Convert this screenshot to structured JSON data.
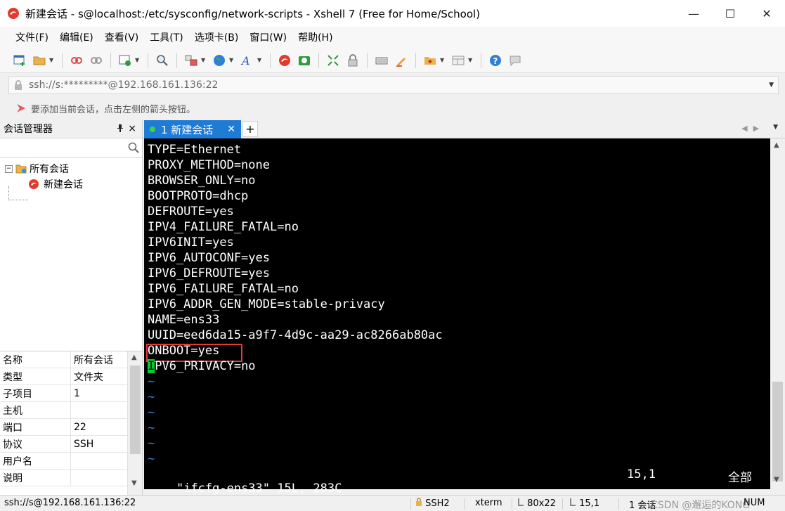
{
  "window": {
    "title": "新建会话 - s@localhost:/etc/sysconfig/network-scripts - Xshell 7 (Free for Home/School)",
    "minimize": "—",
    "maximize": "☐",
    "close": "✕"
  },
  "menu": [
    "文件(F)",
    "编辑(E)",
    "查看(V)",
    "工具(T)",
    "选项卡(B)",
    "窗口(W)",
    "帮助(H)"
  ],
  "address": {
    "value": "ssh://s:*********@192.168.161.136:22"
  },
  "hint": "要添加当前会话，点击左侧的箭头按钮。",
  "session_manager": {
    "title": "会话管理器",
    "pin": "ᵖ",
    "close": "×",
    "search_placeholder": "",
    "tree": {
      "root": "所有会话",
      "toggle": "−",
      "child": "新建会话"
    },
    "properties": [
      {
        "key": "名称",
        "value": "所有会话"
      },
      {
        "key": "类型",
        "value": "文件夹"
      },
      {
        "key": "子项目",
        "value": "1"
      },
      {
        "key": "主机",
        "value": ""
      },
      {
        "key": "端口",
        "value": "22"
      },
      {
        "key": "协议",
        "value": "SSH"
      },
      {
        "key": "用户名",
        "value": ""
      },
      {
        "key": "说明",
        "value": ""
      }
    ]
  },
  "tabs": {
    "active_label": "1 新建会话",
    "close": "✕",
    "add": "+"
  },
  "terminal": {
    "lines": [
      "TYPE=Ethernet",
      "PROXY_METHOD=none",
      "BROWSER_ONLY=no",
      "BOOTPROTO=dhcp",
      "DEFROUTE=yes",
      "IPV4_FAILURE_FATAL=no",
      "IPV6INIT=yes",
      "IPV6_AUTOCONF=yes",
      "IPV6_DEFROUTE=yes",
      "IPV6_FAILURE_FATAL=no",
      "IPV6_ADDR_GEN_MODE=stable-privacy",
      "NAME=ens33",
      "UUID=eed6da15-a9f7-4d9c-aa29-ac8266ab80ac",
      "ONBOOT=yes"
    ],
    "cursor_char": "I",
    "cursor_rest": "PV6_PRIVACY=no",
    "tilde": "~",
    "tilde_count": 6,
    "status_file": "\"ifcfg-ens33\" 15L, 283C",
    "status_pos": "15,1",
    "status_all": "全部"
  },
  "statusbar": {
    "connection": "ssh://s@192.168.161.136:22",
    "protocol": "SSH2",
    "terminal": "xterm",
    "size": "80x22",
    "cursor": "15,1",
    "sessions": "1 会话",
    "num": "NUM",
    "watermark": "CSDN @邂逅的KONG"
  },
  "colors": {
    "accent": "#1e7bd6",
    "highlight": "#e53935",
    "cursor": "#00cc33",
    "tilde": "#3b79d6"
  }
}
